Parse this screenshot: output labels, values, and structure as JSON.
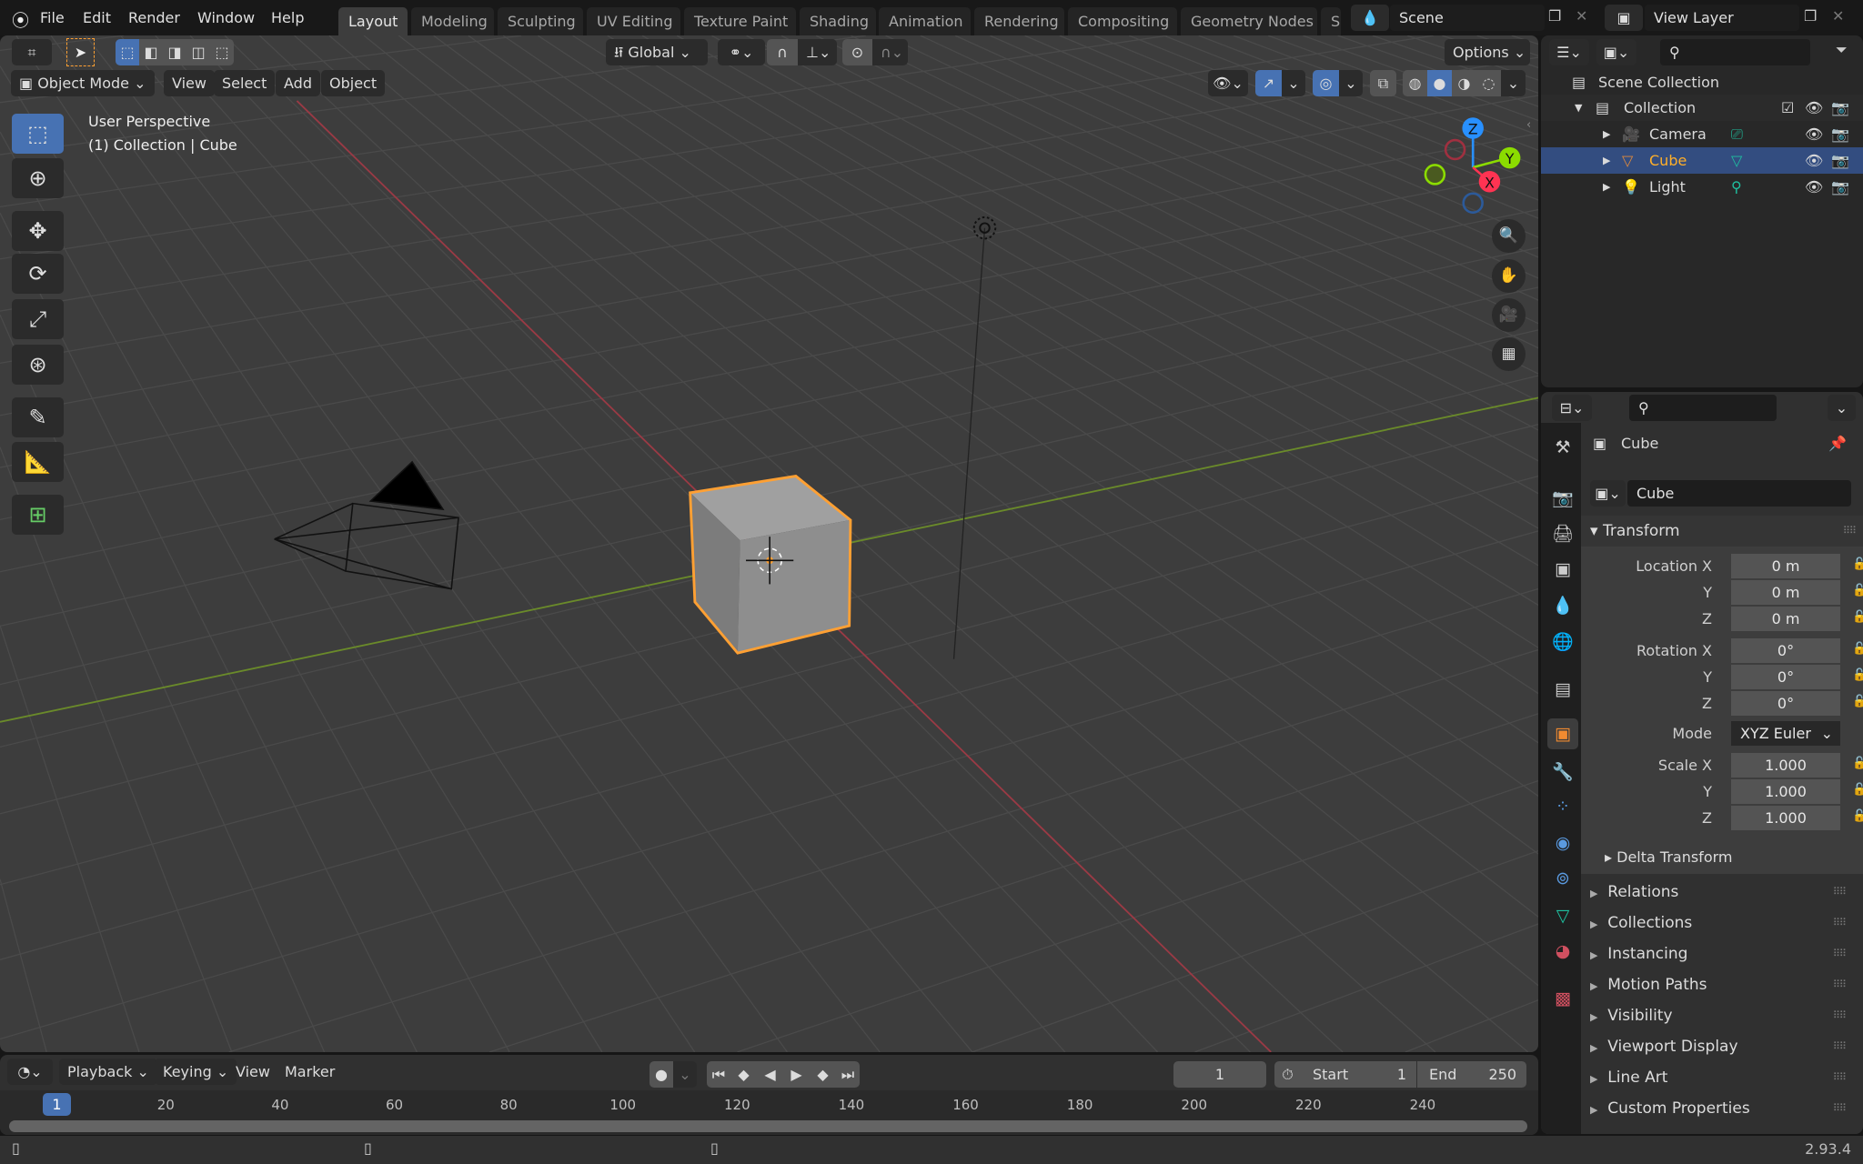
{
  "menu": [
    "File",
    "Edit",
    "Render",
    "Window",
    "Help"
  ],
  "workspaces": [
    "Layout",
    "Modeling",
    "Sculpting",
    "UV Editing",
    "Texture Paint",
    "Shading",
    "Animation",
    "Rendering",
    "Compositing",
    "Geometry Nodes",
    "S"
  ],
  "active_workspace": "Layout",
  "scene": {
    "name": "Scene",
    "view_layer": "View Layer"
  },
  "viewport": {
    "mode": "Object Mode",
    "menus": [
      "View",
      "Select",
      "Add",
      "Object"
    ],
    "transform_orientation": "Global",
    "options_label": "Options",
    "overlay_text": [
      "User Perspective",
      "(1) Collection | Cube"
    ],
    "gizmo_axes": [
      "X",
      "Y",
      "Z"
    ],
    "shading": "solid"
  },
  "outliner": {
    "root": "Scene Collection",
    "collection": "Collection",
    "items": [
      {
        "name": "Camera",
        "type": "camera",
        "selected": false
      },
      {
        "name": "Cube",
        "type": "mesh",
        "selected": true
      },
      {
        "name": "Light",
        "type": "light",
        "selected": false
      }
    ]
  },
  "properties": {
    "object_name": "Cube",
    "datablock": "Cube",
    "transform_title": "Transform",
    "labels": {
      "location": "Location X",
      "rotation": "Rotation X",
      "scale": "Scale X",
      "y": "Y",
      "z": "Z",
      "mode": "Mode"
    },
    "location": [
      "0 m",
      "0 m",
      "0 m"
    ],
    "rotation": [
      "0°",
      "0°",
      "0°"
    ],
    "rotation_mode": "XYZ Euler",
    "scale": [
      "1.000",
      "1.000",
      "1.000"
    ],
    "delta": "Delta Transform",
    "sections": [
      "Relations",
      "Collections",
      "Instancing",
      "Motion Paths",
      "Visibility",
      "Viewport Display",
      "Line Art",
      "Custom Properties"
    ]
  },
  "timeline": {
    "menus": [
      "Playback",
      "Keying",
      "View",
      "Marker"
    ],
    "current_frame": "1",
    "start_label": "Start",
    "start": "1",
    "end_label": "End",
    "end": "250",
    "ticks": [
      "20",
      "40",
      "60",
      "80",
      "100",
      "120",
      "140",
      "160",
      "180",
      "200",
      "220",
      "240"
    ]
  },
  "status": {
    "version": "2.93.4"
  },
  "colors": {
    "accent": "#4772b3",
    "selection": "#ffa033",
    "x_axis": "#ff3352",
    "y_axis": "#8bdc00",
    "z_axis": "#2890ff"
  }
}
